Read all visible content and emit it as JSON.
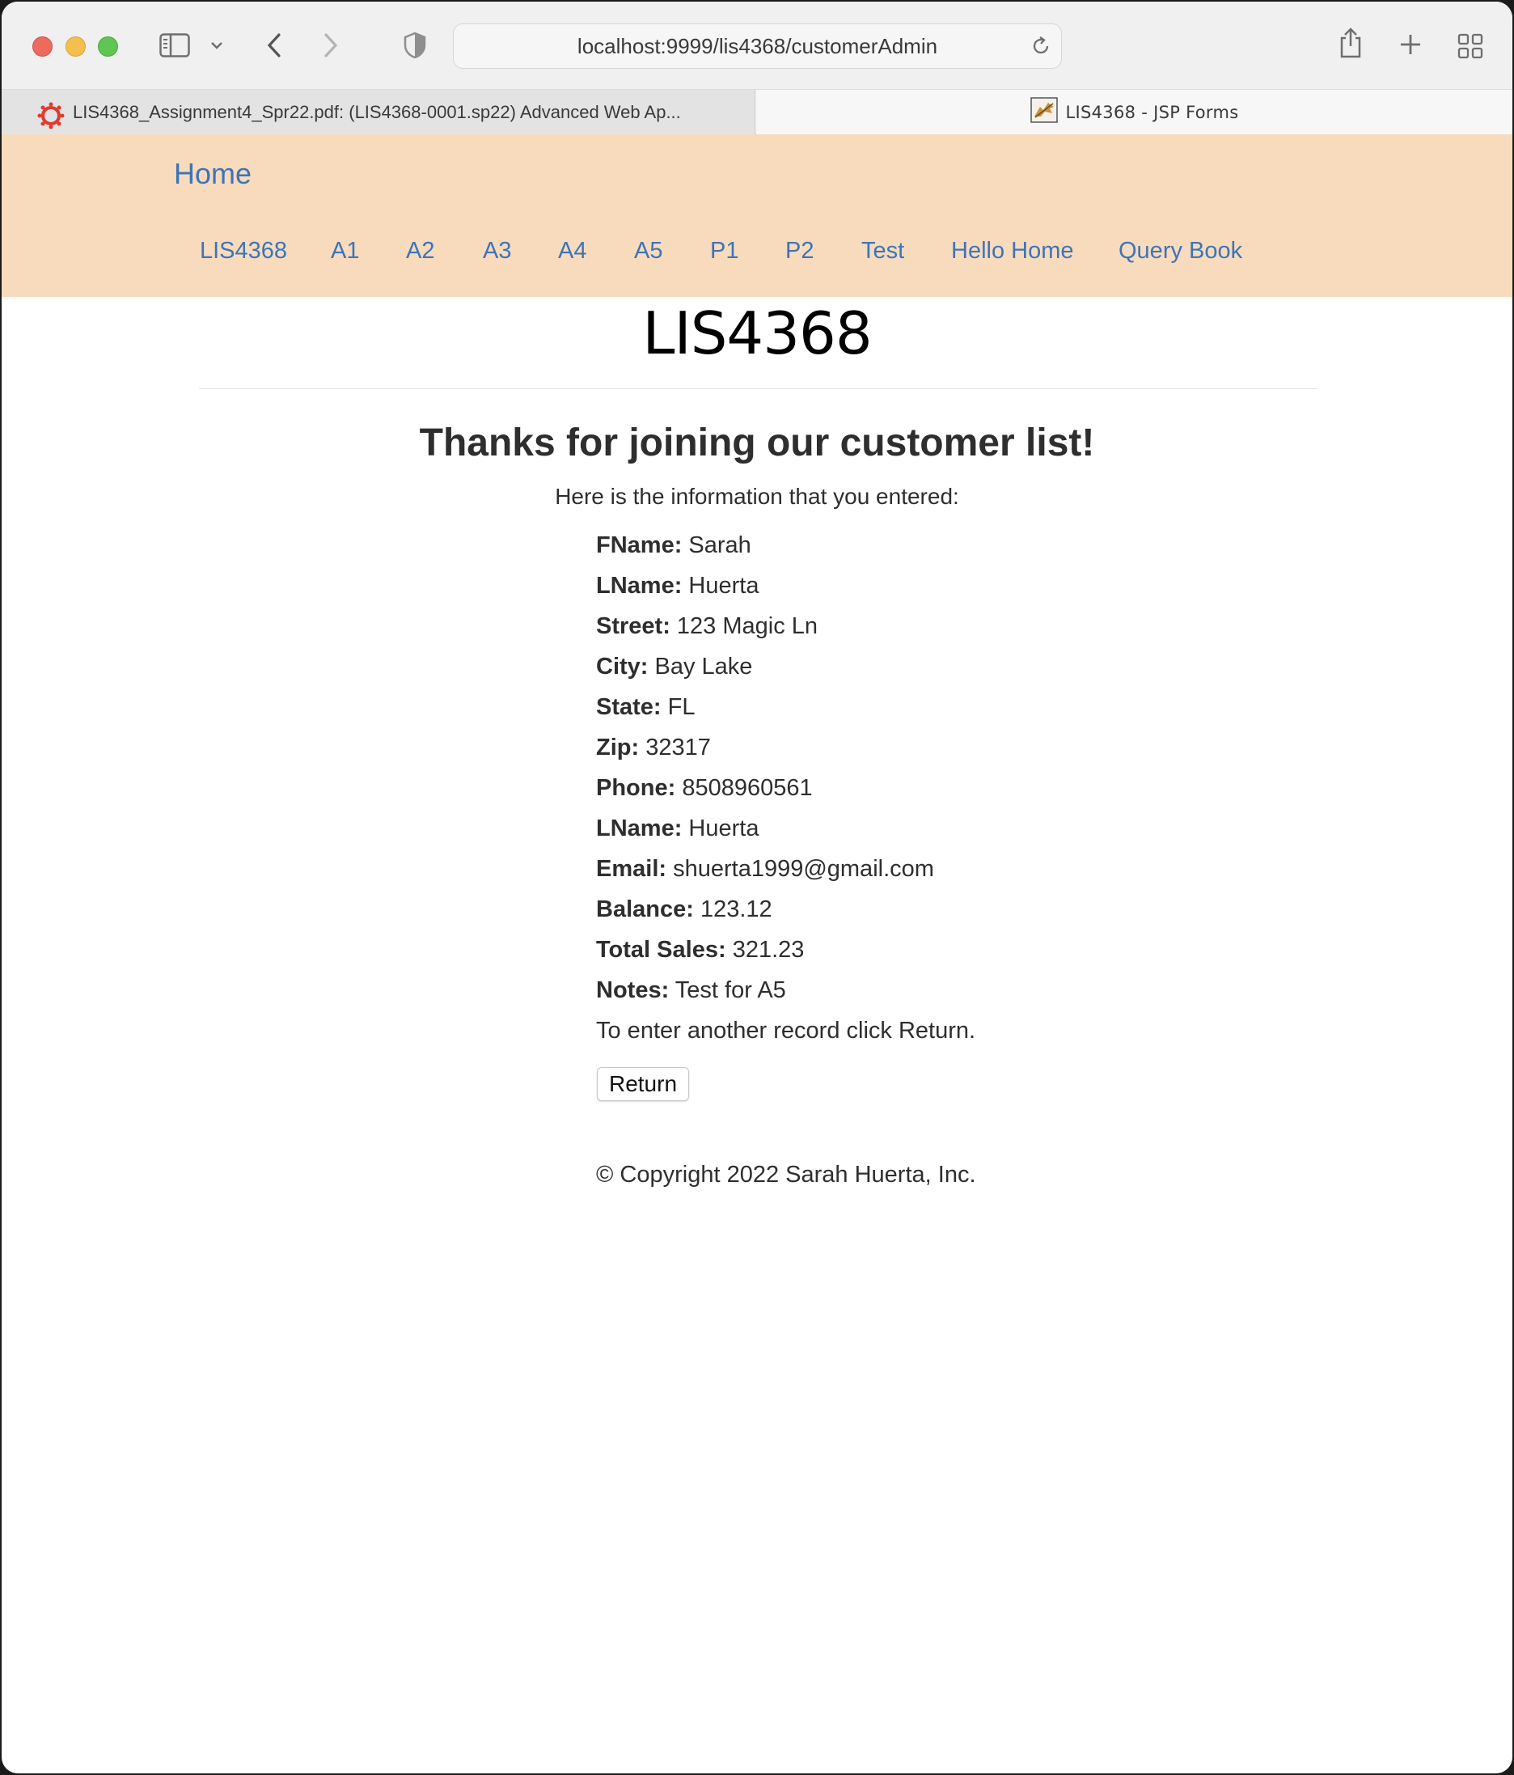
{
  "browser": {
    "url": "localhost:9999/lis4368/customerAdmin",
    "tabs": [
      {
        "title": "LIS4368_Assignment4_Spr22.pdf: (LIS4368-0001.sp22) Advanced Web Ap...",
        "icon": "canvas-lms-icon",
        "active": false
      },
      {
        "title": "LIS4368 - JSP Forms",
        "icon": "tomcat-icon",
        "active": true
      }
    ]
  },
  "navbar": {
    "brand": "Home",
    "links": [
      "LIS4368",
      "A1",
      "A2",
      "A3",
      "A4",
      "A5",
      "P1",
      "P2",
      "Test",
      "Hello Home",
      "Query Book"
    ]
  },
  "page": {
    "title": "LIS4368",
    "heading": "Thanks for joining our customer list!",
    "intro": "Here is the information that you entered:",
    "fields": [
      {
        "label": "FName:",
        "value": "Sarah"
      },
      {
        "label": "LName:",
        "value": "Huerta"
      },
      {
        "label": "Street:",
        "value": "123 Magic Ln"
      },
      {
        "label": "City:",
        "value": "Bay Lake"
      },
      {
        "label": "State:",
        "value": "FL"
      },
      {
        "label": "Zip:",
        "value": "32317"
      },
      {
        "label": "Phone:",
        "value": "8508960561"
      },
      {
        "label": "LName:",
        "value": "Huerta"
      },
      {
        "label": "Email:",
        "value": "shuerta1999@gmail.com"
      },
      {
        "label": "Balance:",
        "value": "123.12"
      },
      {
        "label": "Total Sales:",
        "value": "321.23"
      },
      {
        "label": "Notes:",
        "value": "Test for A5"
      }
    ],
    "return_note": "To enter another record click Return.",
    "return_button": "Return",
    "copyright": "© Copyright 2022 Sarah Huerta, Inc."
  },
  "colors": {
    "navbar_bg": "#f8dbbd",
    "link": "#3d74b8",
    "text": "#2e2e2e"
  }
}
